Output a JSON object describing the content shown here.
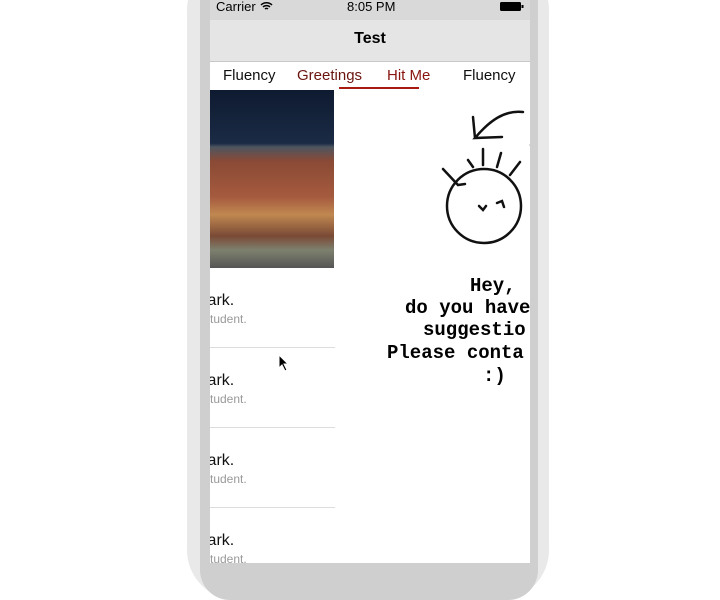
{
  "status": {
    "carrier": "Carrier",
    "time": "8:05 PM"
  },
  "nav": {
    "title": "Test"
  },
  "tabs": [
    {
      "label": "Fluency",
      "color": "#111111"
    },
    {
      "label": "Greetings",
      "color": "#6b1510"
    },
    {
      "label": "Hit Me",
      "color": "#8a1510",
      "selected": true
    },
    {
      "label": "Fluency",
      "color": "#111111"
    }
  ],
  "list": [
    {
      "title": "lark.",
      "subtitle": "student."
    },
    {
      "title": "lark.",
      "subtitle": "student."
    },
    {
      "title": "lark.",
      "subtitle": "student."
    },
    {
      "title": "lark.",
      "subtitle": "student."
    }
  ],
  "message": [
    "Hey,",
    "do you have",
    "suggestio",
    "Please conta",
    ":)"
  ]
}
